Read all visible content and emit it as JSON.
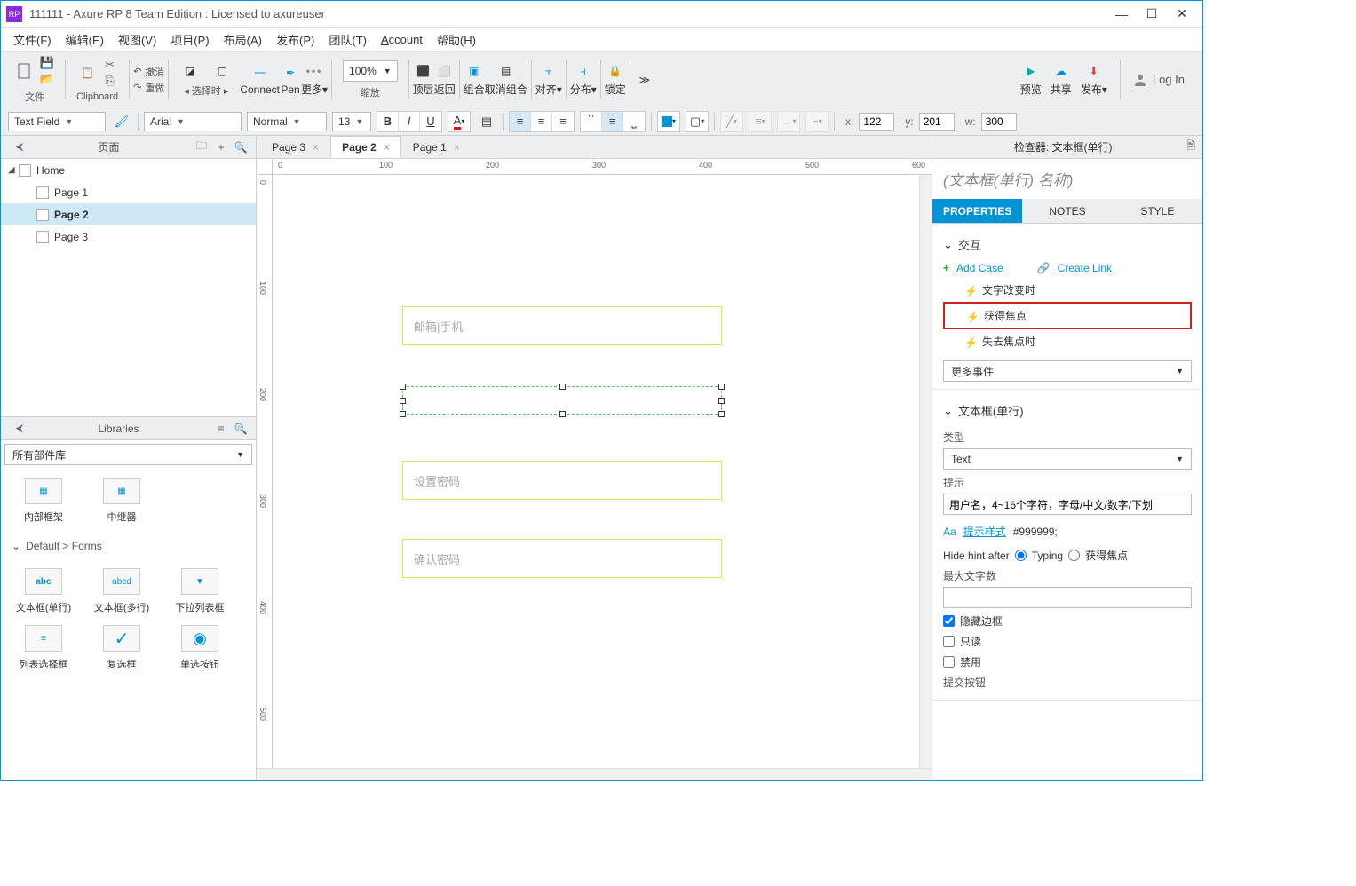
{
  "window": {
    "title": "111111 - Axure RP 8 Team Edition : Licensed to axureuser",
    "logo_text": "RP"
  },
  "menu": [
    "文件(F)",
    "编辑(E)",
    "视图(V)",
    "项目(P)",
    "布局(A)",
    "发布(P)",
    "团队(T)",
    "Account",
    "帮助(H)"
  ],
  "toolbar": {
    "file": "文件",
    "clipboard": "Clipboard",
    "undo": "撤消",
    "redo": "重做",
    "select": "选择时",
    "connect": "Connect",
    "pen": "Pen",
    "more": "更多▾",
    "zoom_value": "100%",
    "zoom_label": "缩放",
    "front": "顶层",
    "back": "返回",
    "group": "组合",
    "ungroup": "取消组合",
    "align": "对齐▾",
    "distribute": "分布▾",
    "lock": "锁定",
    "preview": "预览",
    "share": "共享",
    "publish": "发布▾",
    "login": "Log In"
  },
  "formatbar": {
    "widget_type": "Text Field",
    "font": "Arial",
    "weight": "Normal",
    "size": "13",
    "x_label": "x:",
    "y_label": "y:",
    "w_label": "w:",
    "x_val": "122",
    "y_val": "201",
    "w_val": "300"
  },
  "left": {
    "pages_title": "页面",
    "tree": {
      "root": "Home",
      "children": [
        "Page 1",
        "Page 2",
        "Page 3"
      ],
      "selected": "Page 2"
    },
    "libraries_title": "Libraries",
    "lib_combo": "所有部件库",
    "lib_items1": [
      {
        "label": "内部框架",
        "thumb": "▦"
      },
      {
        "label": "中继器",
        "thumb": "▦"
      }
    ],
    "lib_section": "Default > Forms",
    "lib_items2": [
      {
        "label": "文本框(单行)",
        "thumb": "abc"
      },
      {
        "label": "文本框(多行)",
        "thumb": "abcd"
      },
      {
        "label": "下拉列表框",
        "thumb": "▼"
      },
      {
        "label": "列表选择框",
        "thumb": "≡"
      },
      {
        "label": "复选框",
        "thumb": "✓"
      },
      {
        "label": "单选按钮",
        "thumb": "◉"
      }
    ]
  },
  "tabs": [
    "Page 3",
    "Page 2",
    "Page 1"
  ],
  "active_tab": "Page 2",
  "ruler_h": [
    "0",
    "100",
    "200",
    "300",
    "400",
    "500",
    "600"
  ],
  "ruler_v": [
    "0",
    "100",
    "200",
    "300",
    "400",
    "500"
  ],
  "canvas": {
    "input1": "邮箱|手机",
    "input2": "设置密码",
    "input3": "确认密码"
  },
  "inspector": {
    "header": "检查器: 文本框(单行)",
    "name_placeholder": "(文本框(单行) 名称)",
    "tabs": [
      "PROPERTIES",
      "NOTES",
      "STYLE"
    ],
    "active_tab": "PROPERTIES",
    "section_interact": "交互",
    "add_case": "Add Case",
    "create_link": "Create Link",
    "events": [
      "文字改变时",
      "获得焦点",
      "失去焦点时"
    ],
    "highlighted_event": "获得焦点",
    "more_events": "更多事件",
    "section_widget": "文本框(单行)",
    "type_label": "类型",
    "type_value": "Text",
    "hint_label": "提示",
    "hint_value": "用户名，4~16个字符，字母/中文/数字/下划",
    "hint_style": "提示样式",
    "hint_color": "#999999;",
    "hide_hint_label": "Hide hint after",
    "hide_hint_opt1": "Typing",
    "hide_hint_opt2": "获得焦点",
    "maxlen_label": "最大文字数",
    "hide_border": "隐藏边框",
    "readonly": "只读",
    "disabled": "禁用",
    "submit_btn": "提交按钮"
  }
}
